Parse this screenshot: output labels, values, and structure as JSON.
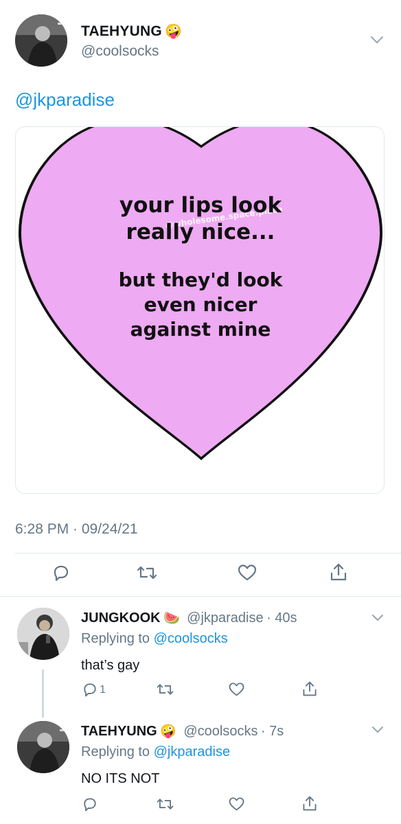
{
  "main_tweet": {
    "display_name": "TAEHYUNG",
    "name_emoji": "🤪",
    "handle": "@coolsocks",
    "body": "@jkparadise",
    "image": {
      "watermark": "@wholesome.space.place",
      "line1": "your lips look",
      "line2": "really nice...",
      "line3": "but they'd look",
      "line4": "even nicer",
      "line5": "against mine",
      "heart_color": "#eeaaf2"
    },
    "timestamp": "6:28 PM · 09/24/21"
  },
  "replies": [
    {
      "display_name": "JUNGKOOK",
      "name_emoji": "🍉",
      "handle": "@jkparadise",
      "time": "· 40s",
      "replying_prefix": "Replying to ",
      "replying_to": "@coolsocks",
      "text": "that’s gay",
      "reply_count": "1"
    },
    {
      "display_name": "TAEHYUNG",
      "name_emoji": "🤪",
      "handle": "@coolsocks",
      "time": "· 7s",
      "replying_prefix": "Replying to ",
      "replying_to": "@jkparadise",
      "text": "NO ITS NOT",
      "reply_count": ""
    }
  ],
  "colors": {
    "link": "#1b95e0",
    "secondary_text": "#657786",
    "divider": "#e1e8ed"
  }
}
